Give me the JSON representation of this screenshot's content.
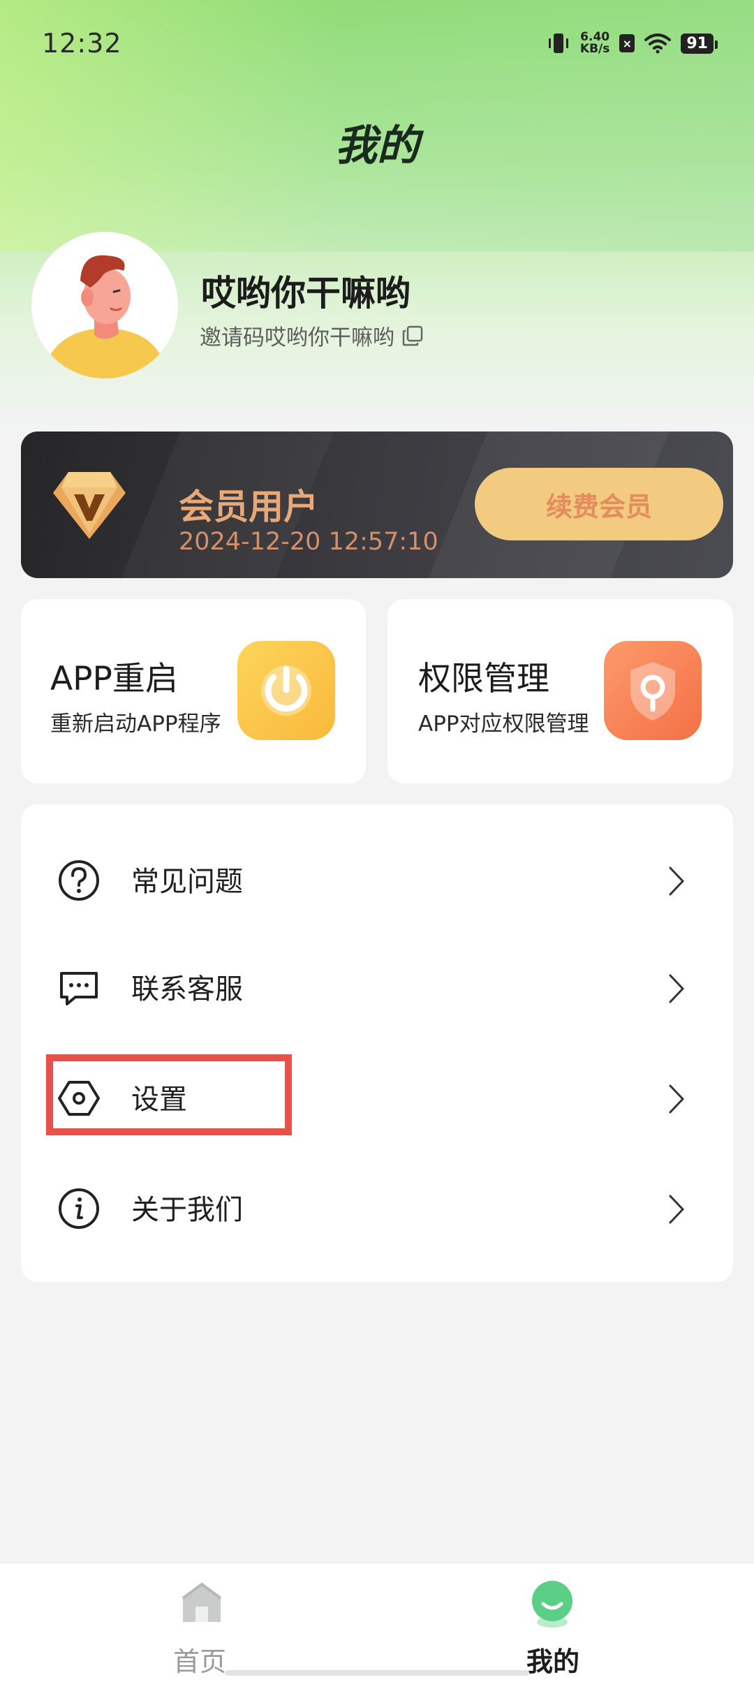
{
  "status_bar": {
    "time": "12:32",
    "net_speed": "6.40",
    "net_unit": "KB/s",
    "battery": "91"
  },
  "page": {
    "title": "我的"
  },
  "profile": {
    "name": "哎哟你干嘛哟",
    "invite": "邀请码哎哟你干嘛哟"
  },
  "vip": {
    "title": "会员用户",
    "expire": "2024-12-20 12:57:10",
    "renew_label": "续费会员"
  },
  "quick_cards": [
    {
      "title": "APP重启",
      "subtitle": "重新启动APP程序",
      "icon": "power-icon",
      "color": "#fcc64e"
    },
    {
      "title": "权限管理",
      "subtitle": "APP对应权限管理",
      "icon": "shield-lock-icon",
      "color": "#f98459"
    }
  ],
  "menu": [
    {
      "label": "常见问题",
      "icon": "question-circle-icon"
    },
    {
      "label": "联系客服",
      "icon": "chat-bubble-icon"
    },
    {
      "label": "设置",
      "icon": "settings-hexagon-icon"
    },
    {
      "label": "关于我们",
      "icon": "info-circle-icon"
    }
  ],
  "tabbar": {
    "home": "首页",
    "mine": "我的"
  },
  "colors": {
    "accent_green": "#5ccf86",
    "highlight_red": "#e8504a"
  }
}
